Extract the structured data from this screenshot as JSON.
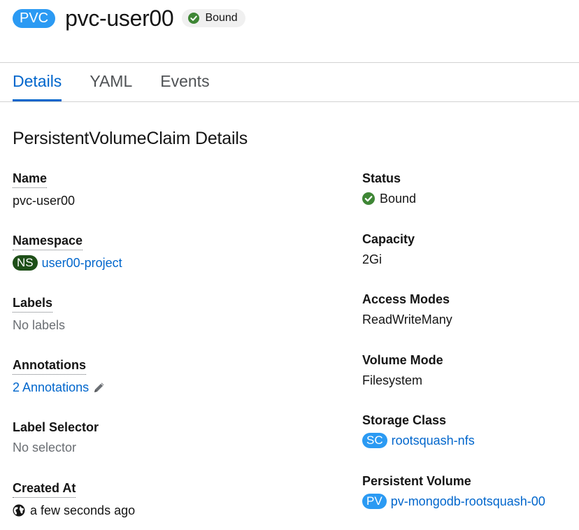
{
  "header": {
    "kind_badge": "PVC",
    "kind_badge_color": "#2b9af3",
    "title": "pvc-user00",
    "status": "Bound",
    "status_color": "#3e8635"
  },
  "tabs": [
    {
      "label": "Details",
      "active": true
    },
    {
      "label": "YAML",
      "active": false
    },
    {
      "label": "Events",
      "active": false
    }
  ],
  "section_title": "PersistentVolumeClaim Details",
  "left": {
    "name": {
      "label": "Name",
      "value": "pvc-user00"
    },
    "namespace": {
      "label": "Namespace",
      "badge": "NS",
      "badge_color": "#1e4f18",
      "value": "user00-project"
    },
    "labels": {
      "label": "Labels",
      "value": "No labels"
    },
    "annotations": {
      "label": "Annotations",
      "value": "2 Annotations",
      "icon": "pencil-icon"
    },
    "label_selector": {
      "label": "Label Selector",
      "value": "No selector"
    },
    "created_at": {
      "label": "Created At",
      "value": "a few seconds ago",
      "icon": "globe-icon"
    }
  },
  "right": {
    "status": {
      "label": "Status",
      "value": "Bound",
      "icon": "check-circle-icon"
    },
    "capacity": {
      "label": "Capacity",
      "value": "2Gi"
    },
    "access_modes": {
      "label": "Access Modes",
      "value": "ReadWriteMany"
    },
    "volume_mode": {
      "label": "Volume Mode",
      "value": "Filesystem"
    },
    "storage_class": {
      "label": "Storage Class",
      "badge": "SC",
      "badge_color": "#2b9af3",
      "value": "rootsquash-nfs"
    },
    "persistent_volume": {
      "label": "Persistent Volume",
      "badge": "PV",
      "badge_color": "#2b9af3",
      "value": "pv-mongodb-rootsquash-00"
    }
  },
  "colors": {
    "link": "#0066cc",
    "muted": "#6a6e73",
    "success": "#3e8635"
  }
}
